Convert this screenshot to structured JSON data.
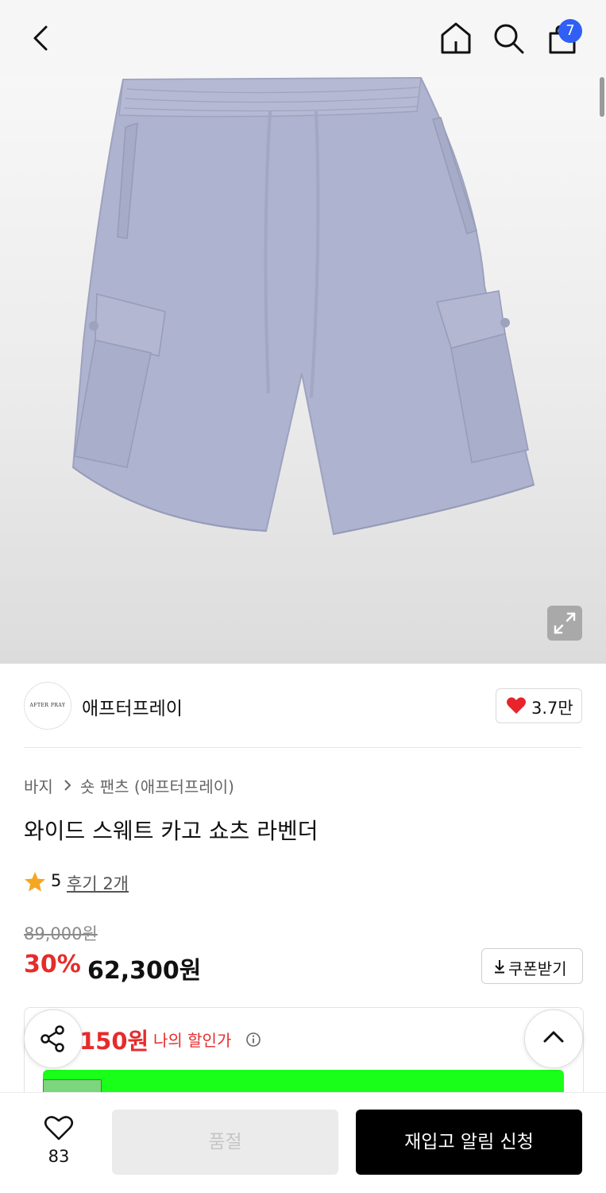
{
  "header": {
    "cart_count": "7",
    "icons": [
      "back-arrow-icon",
      "home-icon",
      "search-icon",
      "shopping-bag-icon"
    ]
  },
  "brand": {
    "logo_text": "AFTER PRAY",
    "name": "애프터프레이",
    "likes": "3.7만"
  },
  "breadcrumb": {
    "category": "바지",
    "subcategory": "숏 팬츠 (애프터프레이)"
  },
  "product": {
    "title": "와이드 스웨트 카고 쇼츠 라벤더",
    "rating": "5",
    "reviews": "후기 2개",
    "original_price": "89,000원",
    "discount_percent": "30%",
    "sale_price": "62,300원",
    "coupon_label": "쿠폰받기",
    "my_price_amount": "150원",
    "my_price_label": "나의 할인가"
  },
  "bottom_bar": {
    "wish_count": "83",
    "soldout_label": "품절",
    "restock_label": "재입고 알림 신청"
  },
  "colors": {
    "accent_red": "#e62b2b",
    "badge_blue": "#2f5ff5",
    "banner_green": "#19ff19",
    "product_lavender": "#aeb3cf"
  }
}
